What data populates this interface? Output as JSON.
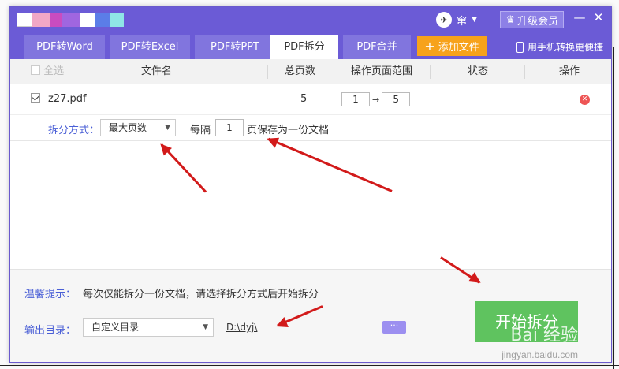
{
  "titlebar": {
    "user_name": "窜",
    "vip_label": "升级会员",
    "minimize": "—",
    "close": "✕"
  },
  "tabs": [
    {
      "label": "PDF转Word"
    },
    {
      "label": "PDF转Excel"
    },
    {
      "label": "PDF转PPT"
    },
    {
      "label": "PDF拆分",
      "active": true
    },
    {
      "label": "PDF合并"
    }
  ],
  "toolbar": {
    "add_file": "添加文件",
    "mobile_convert": "用手机转换更便捷"
  },
  "table": {
    "columns": [
      "全选",
      "文件名",
      "总页数",
      "操作页面范围",
      "状态",
      "操作"
    ],
    "rows": [
      {
        "checked": true,
        "filename": "z27.pdf",
        "total_pages": "5",
        "range_from": "1",
        "range_arrow": "→",
        "range_to": "5",
        "status": ""
      }
    ]
  },
  "split": {
    "method_label": "拆分方式：",
    "method_value": "最大页数",
    "every_label": "每隔",
    "every_value": "1",
    "save_label": "页保存为一份文档"
  },
  "bottom": {
    "tip_label": "温馨提示：",
    "tip_text": "每次仅能拆分一份文档，请选择拆分方式后开始拆分",
    "output_label": "输出目录：",
    "output_option": "自定义目录",
    "output_path": "D:\\dyj\\",
    "browse": "···",
    "start_button": "开始拆分"
  },
  "watermark": {
    "brand": "Bai 经验",
    "url": "jingyan.baidu.com"
  },
  "colors": {
    "accent": "#6b5bd6",
    "tab_inactive": "#8175de",
    "add_button": "#f7a21b",
    "start_button": "#5fc35f",
    "arrow": "#d21a1a"
  }
}
